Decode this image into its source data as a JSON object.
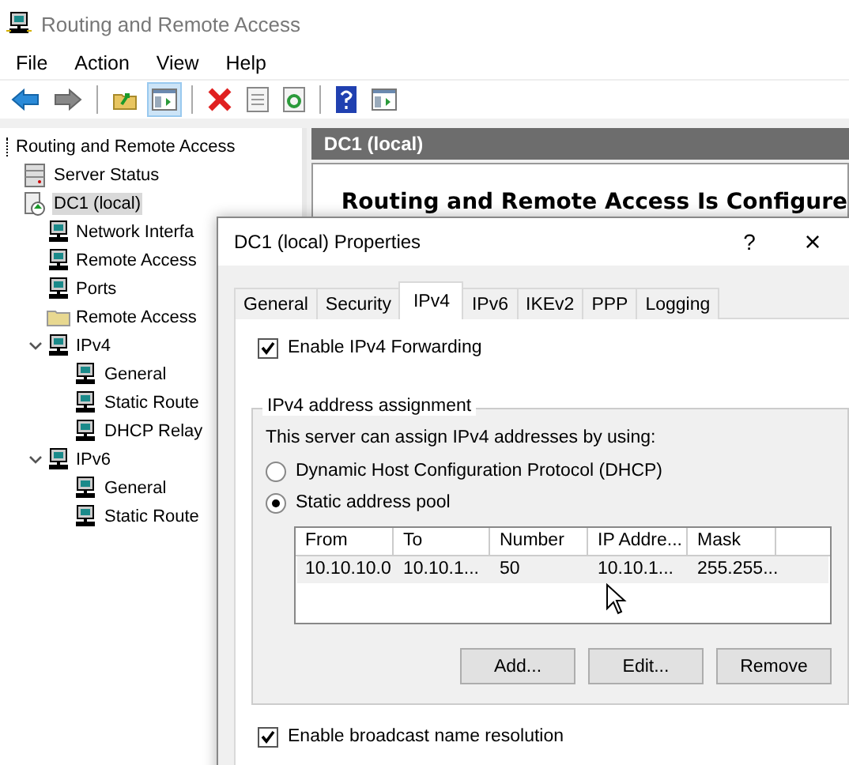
{
  "window": {
    "title": "Routing and Remote Access"
  },
  "menu": [
    "File",
    "Action",
    "View",
    "Help"
  ],
  "toolbar": [
    {
      "kind": "back",
      "selected": false
    },
    {
      "kind": "forward",
      "selected": false
    },
    {
      "kind": "up",
      "selected": false
    },
    {
      "kind": "pane",
      "selected": true
    },
    {
      "kind": "delete",
      "selected": false
    },
    {
      "kind": "properties",
      "selected": false
    },
    {
      "kind": "refresh",
      "selected": false
    },
    {
      "kind": "help",
      "selected": false
    },
    {
      "kind": "show",
      "selected": false
    }
  ],
  "tree": {
    "root": "Routing and Remote Access",
    "items": [
      {
        "label": "Server Status",
        "kind": "servers",
        "selected": false
      },
      {
        "label": "DC1 (local)",
        "kind": "server",
        "selected": true,
        "children": [
          {
            "label": "Network Interfa",
            "kind": "computer",
            "selected": false
          },
          {
            "label": "Remote Access",
            "kind": "computer",
            "selected": false
          },
          {
            "label": "Ports",
            "kind": "computer",
            "selected": false
          },
          {
            "label": "Remote Access",
            "kind": "folder",
            "selected": false
          },
          {
            "label": "IPv4",
            "kind": "computer",
            "selected": false,
            "expanded": true,
            "children": [
              {
                "label": "General",
                "selected": false
              },
              {
                "label": "Static Route",
                "selected": false
              },
              {
                "label": "DHCP Relay",
                "selected": false
              }
            ]
          },
          {
            "label": "IPv6",
            "kind": "computer",
            "selected": false,
            "expanded": true,
            "children": [
              {
                "label": "General",
                "selected": false
              },
              {
                "label": "Static Route",
                "selected": false
              }
            ]
          }
        ]
      }
    ]
  },
  "details": {
    "header": "DC1 (local)",
    "heading": "Routing and Remote Access Is Configure"
  },
  "dialog": {
    "title": "DC1 (local) Properties",
    "help": "?",
    "close": "×",
    "tabs": [
      {
        "label": "General",
        "selected": false
      },
      {
        "label": "Security",
        "selected": false
      },
      {
        "label": "IPv4",
        "selected": true
      },
      {
        "label": "IPv6",
        "selected": false
      },
      {
        "label": "IKEv2",
        "selected": false
      },
      {
        "label": "PPP",
        "selected": false
      },
      {
        "label": "Logging",
        "selected": false
      }
    ],
    "forwarding": {
      "label": "Enable IPv4 Forwarding",
      "checked": true
    },
    "group": {
      "legend": "IPv4 address assignment",
      "intro": "This server can assign IPv4 addresses by using:",
      "options": [
        {
          "label": "Dynamic Host Configuration Protocol (DHCP)",
          "selected": false
        },
        {
          "label": "Static address pool",
          "selected": true
        }
      ],
      "table": {
        "columns": [
          "From",
          "To",
          "Number",
          "IP Addre...",
          "Mask"
        ],
        "rows": [
          [
            "10.10.10.0",
            "10.10.1...",
            "50",
            "10.10.1...",
            "255.255..."
          ]
        ]
      },
      "buttons": [
        "Add...",
        "Edit...",
        "Remove"
      ]
    },
    "broadcast": {
      "label": "Enable broadcast name resolution",
      "checked": true
    }
  }
}
